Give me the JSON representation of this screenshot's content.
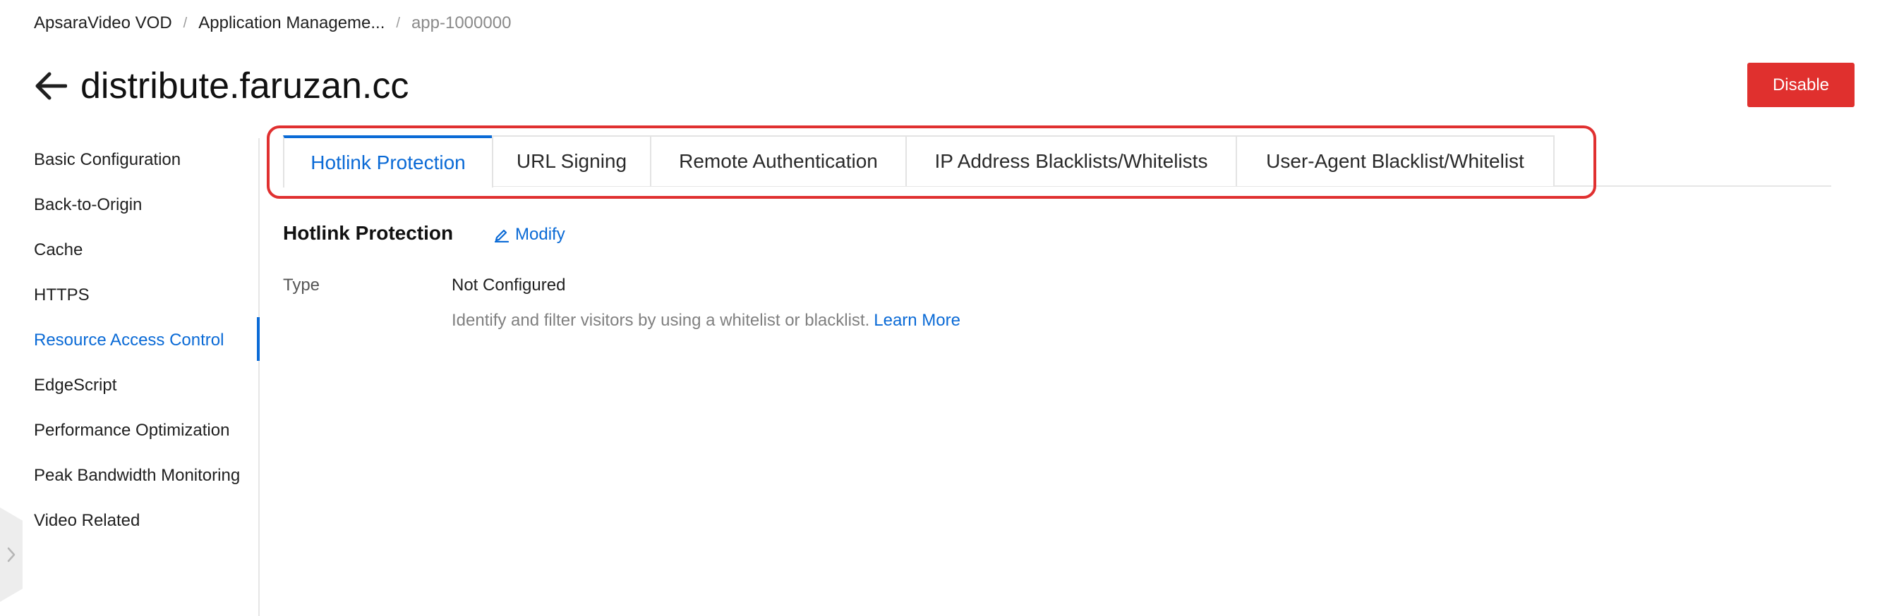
{
  "breadcrumb": {
    "items": [
      "ApsaraVideo VOD",
      "Application Manageme...",
      "app-1000000"
    ],
    "separator": "/"
  },
  "header": {
    "title": "distribute.faruzan.cc",
    "back_icon": "arrow-left-icon",
    "disable_label": "Disable"
  },
  "sidebar": {
    "items": [
      {
        "label": "Basic Configuration"
      },
      {
        "label": "Back-to-Origin"
      },
      {
        "label": "Cache"
      },
      {
        "label": "HTTPS"
      },
      {
        "label": "Resource Access Control",
        "active": true
      },
      {
        "label": "EdgeScript"
      },
      {
        "label": "Performance Optimization"
      },
      {
        "label": "Peak Bandwidth Monitoring"
      },
      {
        "label": "Video Related"
      }
    ]
  },
  "tabs": {
    "items": [
      {
        "label": "Hotlink Protection",
        "active": true
      },
      {
        "label": "URL Signing"
      },
      {
        "label": "Remote Authentication"
      },
      {
        "label": "IP Address Blacklists/Whitelists"
      },
      {
        "label": "User-Agent Blacklist/Whitelist"
      }
    ]
  },
  "content": {
    "section_title": "Hotlink Protection",
    "modify_label": "Modify",
    "modify_icon": "edit-pencil-icon",
    "type_label": "Type",
    "type_value": "Not Configured",
    "help_text": "Identify and filter visitors by using a whitelist or blacklist.",
    "learn_more": "Learn More"
  },
  "colors": {
    "accent": "#0a6ad6",
    "danger": "#e0302e",
    "highlight": "#e03030"
  }
}
